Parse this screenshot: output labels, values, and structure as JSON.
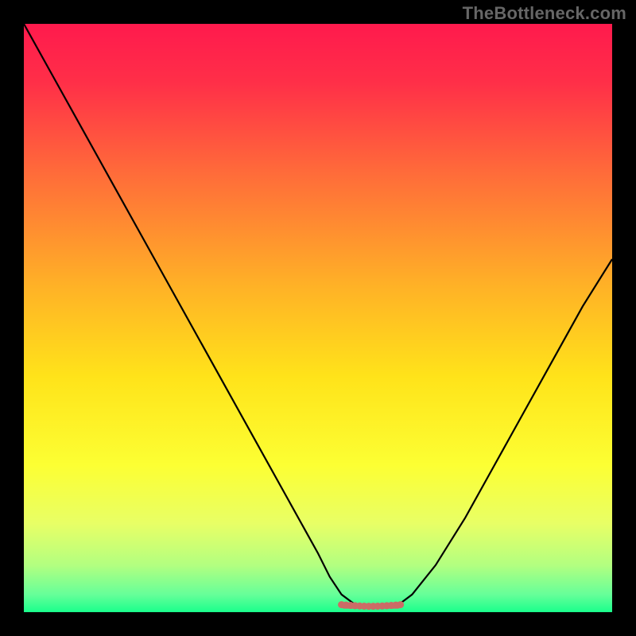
{
  "watermark": "TheBottleneck.com",
  "chart_data": {
    "type": "line",
    "title": "",
    "xlabel": "",
    "ylabel": "",
    "xlim": [
      0,
      100
    ],
    "ylim": [
      0,
      100
    ],
    "x": [
      0,
      5,
      10,
      15,
      20,
      25,
      30,
      35,
      40,
      45,
      50,
      52,
      54,
      56,
      58,
      60,
      62,
      64,
      66,
      70,
      75,
      80,
      85,
      90,
      95,
      100
    ],
    "values": [
      100,
      91,
      82,
      73,
      64,
      55,
      46,
      37,
      28,
      19,
      10,
      6,
      3,
      1.5,
      1,
      1,
      1,
      1.5,
      3,
      8,
      16,
      25,
      34,
      43,
      52,
      60
    ],
    "flat_segment": {
      "x_start": 54,
      "x_end": 64,
      "y": 1,
      "marker_color": "#cc6b66"
    },
    "gradient_stops": [
      {
        "pos": 0.0,
        "color": "#ff1a4d"
      },
      {
        "pos": 0.1,
        "color": "#ff2f48"
      },
      {
        "pos": 0.25,
        "color": "#ff6a3a"
      },
      {
        "pos": 0.45,
        "color": "#ffb326"
      },
      {
        "pos": 0.6,
        "color": "#ffe31a"
      },
      {
        "pos": 0.75,
        "color": "#fcff33"
      },
      {
        "pos": 0.85,
        "color": "#e8ff66"
      },
      {
        "pos": 0.92,
        "color": "#b3ff80"
      },
      {
        "pos": 0.97,
        "color": "#66ff99"
      },
      {
        "pos": 1.0,
        "color": "#1aff8c"
      }
    ]
  }
}
